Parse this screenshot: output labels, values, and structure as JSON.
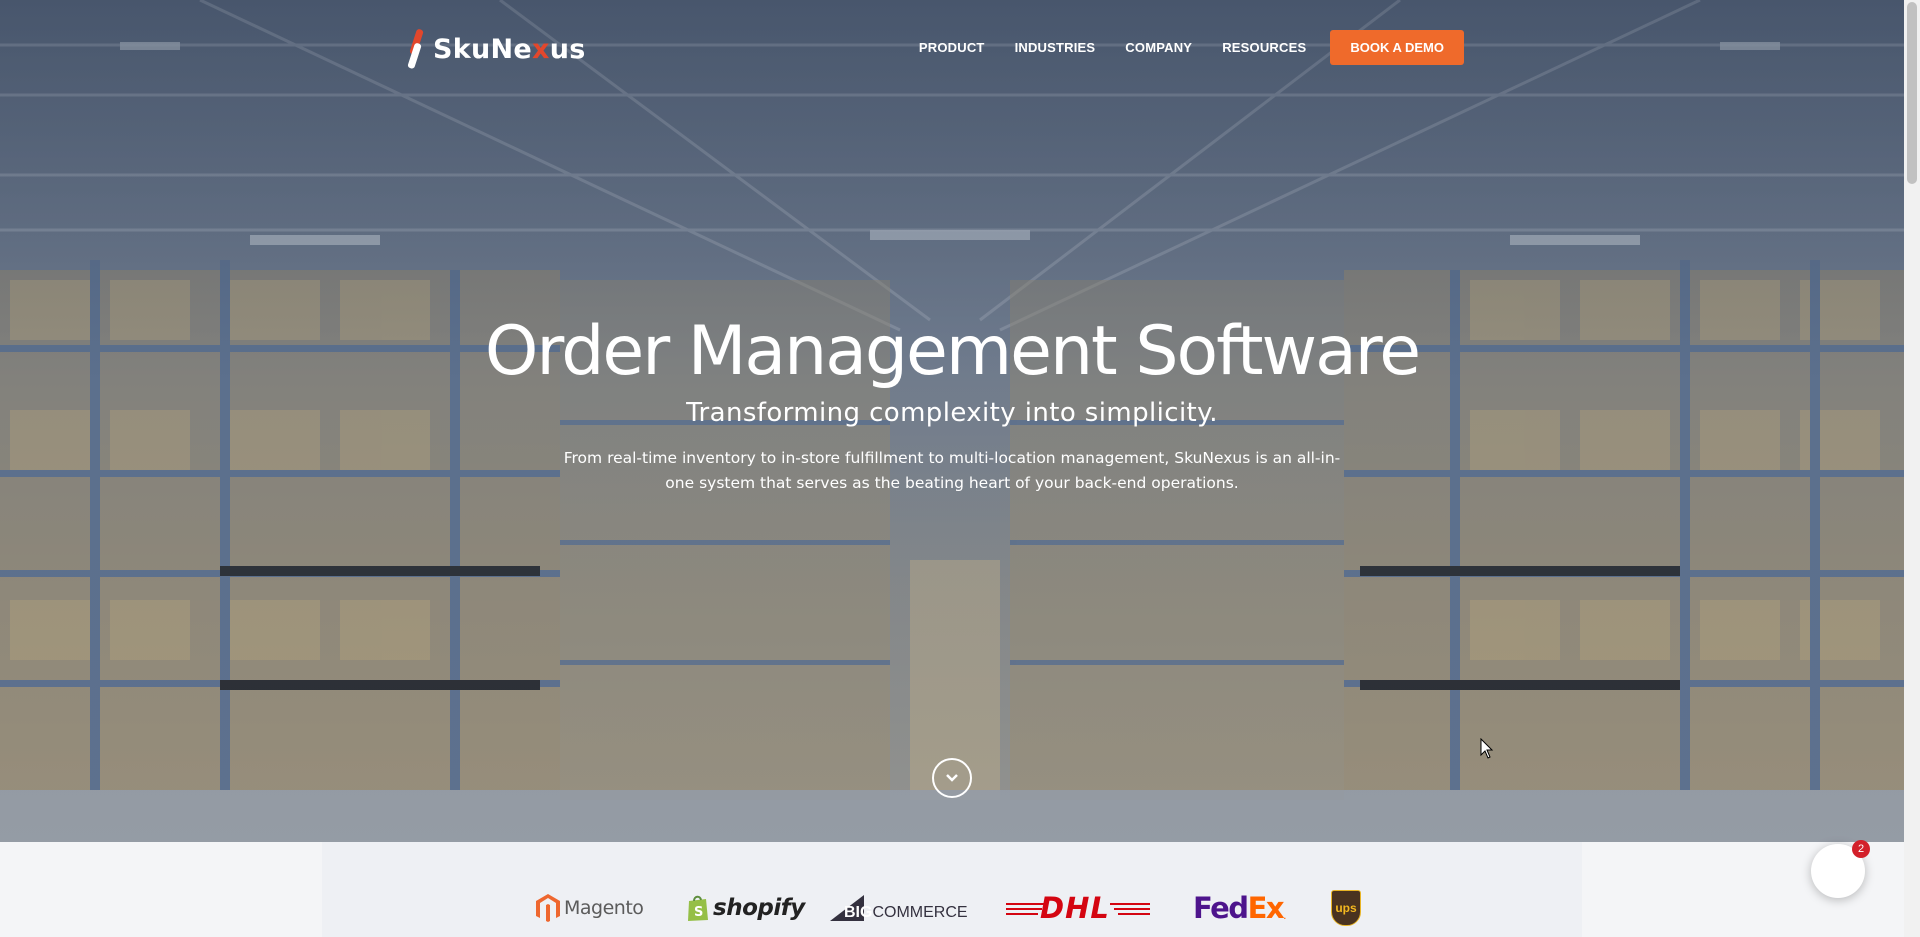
{
  "brand": {
    "name_left": "SkuNe",
    "name_x": "x",
    "name_right": "us"
  },
  "nav": {
    "items": [
      "PRODUCT",
      "INDUSTRIES",
      "COMPANY",
      "RESOURCES"
    ],
    "cta": "BOOK A DEMO"
  },
  "hero": {
    "title": "Order Management Software",
    "subtitle": "Transforming complexity into simplicity.",
    "description": "From real-time inventory to in-store fulfillment to multi-location management, SkuNexus is an all-in-one system that serves as the beating heart of your back-end operations."
  },
  "partners": {
    "magento": "Magento",
    "shopify": "shopify",
    "bigcommerce_big": "BIG",
    "bigcommerce_rest": "COMMERCE",
    "dhl": "DHL",
    "fedex_fed": "Fed",
    "fedex_ex": "Ex",
    "ups": "ups"
  },
  "chat": {
    "badge_count": "2"
  },
  "colors": {
    "accent": "#ef6a2b",
    "badge": "#d3202a",
    "fedex_purple": "#4d148c",
    "fedex_orange": "#ff6600",
    "dhl_red": "#d40511"
  },
  "icons": [
    "chevron-down-icon",
    "chat-icon",
    "mouse-cursor-icon"
  ]
}
